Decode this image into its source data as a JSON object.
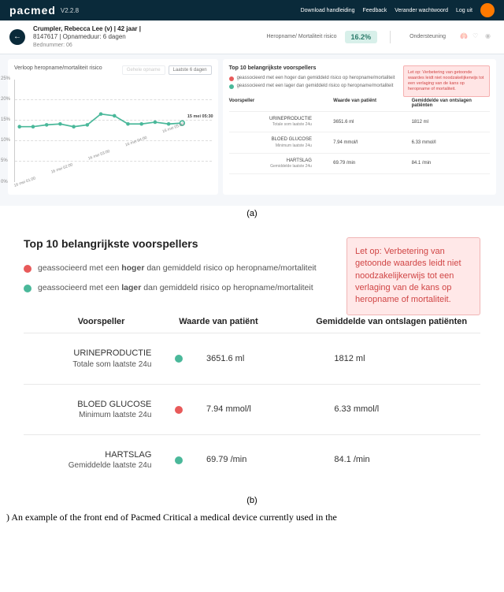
{
  "header": {
    "logo": "pacmed",
    "version": "V2.2.8",
    "download": "Download handleiding",
    "feedback": "Feedback",
    "change_pw": "Verander wachtwoord",
    "logout": "Log uit"
  },
  "patient": {
    "name_line": "Crumpler, Rebecca Lee (v) | 42 jaar |",
    "id_line": "8147617 | Opnameduur: 6 dagen",
    "bed": "Bednummer: 06",
    "risk_label": "Heropname/ Mortaliteit risico",
    "risk_value": "16.2%",
    "support": "Ondersteuning"
  },
  "chart": {
    "title": "Verloop heropname/mortaliteit risico",
    "btn1": "Gehele opname",
    "btn2": "Laatste 6 dagen",
    "annotation": "15 mei 05:30"
  },
  "chart_data": {
    "type": "line",
    "title": "Verloop heropname/mortaliteit risico",
    "xlabel": "",
    "ylabel": "",
    "ylim": [
      0,
      25
    ],
    "yticks": [
      "0%",
      "5%",
      "10%",
      "15%",
      "20%",
      "25%"
    ],
    "x": [
      "16 mei 01:00",
      "16 mei 02:00",
      "16 mei 03:00",
      "16 mei 04:00",
      "16 mei 05:00"
    ],
    "values": [
      15,
      15,
      15.5,
      16,
      15,
      15.5,
      18,
      17.5,
      16,
      16,
      16.5,
      16,
      16.2
    ]
  },
  "top10": {
    "title": "Top 10 belangrijkste voorspellers",
    "legend_high": "geassocieerd met een hoger dan gemiddeld risico op heropname/mortaliteit",
    "legend_low": "geassocieerd met een lager dan gemiddeld risico op heropname/mortaliteit",
    "warning": "Let op: Verbetering van getoonde waardes leidt niet noodzakelijkerwijs tot een verlaging van de kans op heropname of mortaliteit.",
    "col1": "Voorspeller",
    "col2": "Waarde van patiënt",
    "col3": "Gemiddelde van ontslagen patiënten",
    "rows": [
      {
        "name": "URINEPRODUCTIE",
        "sub": "Totale som laatste 24u",
        "dot": "green",
        "val": "3651.6 ml",
        "avg": "1812 ml"
      },
      {
        "name": "BLOED GLUCOSE",
        "sub": "Minimum laatste 24u",
        "dot": "red",
        "val": "7.94 mmol/l",
        "avg": "6.33 mmol/l"
      },
      {
        "name": "HARTSLAG",
        "sub": "Gemiddelde laatste 24u",
        "dot": "green",
        "val": "69.79 /min",
        "avg": "84.1 /min"
      }
    ]
  },
  "b": {
    "title": "Top 10 belangrijkste voorspellers",
    "legend_high_pre": "geassocieerd met een ",
    "legend_high_bold": "hoger",
    "legend_high_post": " dan gemiddeld risico op heropname/mortaliteit",
    "legend_low_pre": "geassocieerd met een ",
    "legend_low_bold": "lager",
    "legend_low_post": " dan gemiddeld risico op heropname/mortaliteit",
    "warning": "Let op: Verbetering van getoonde waardes leidt niet noodzakelijkerwijs tot een verlaging van de kans op heropname of mortaliteit.",
    "col1": "Voorspeller",
    "col2": "Waarde van patiënt",
    "col3": "Gemiddelde van ontslagen patiënten",
    "rows": [
      {
        "name": "URINEPRODUCTIE",
        "sub": "Totale som laatste 24u",
        "dot": "green",
        "val": "3651.6 ml",
        "avg": "1812 ml"
      },
      {
        "name": "BLOED GLUCOSE",
        "sub": "Minimum laatste 24u",
        "dot": "red",
        "val": "7.94 mmol/l",
        "avg": "6.33 mmol/l"
      },
      {
        "name": "HARTSLAG",
        "sub": "Gemiddelde laatste 24u",
        "dot": "green",
        "val": "69.79 /min",
        "avg": "84.1 /min"
      }
    ]
  },
  "captions": {
    "a": "(a)",
    "b": "(b)"
  },
  "footer": ") An example of the front end of Pacmed Critical  a medical device currently used in the"
}
